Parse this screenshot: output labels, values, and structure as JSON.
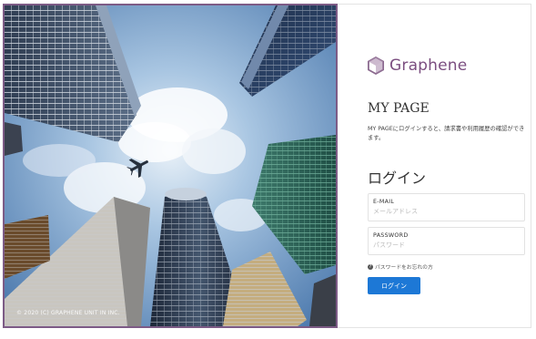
{
  "hero": {
    "copyright": "© 2020 (C) GRAPHENE UNIT IN INC."
  },
  "brand": {
    "name": "Graphene",
    "color": "#7b4e80"
  },
  "page": {
    "title": "MY PAGE",
    "intro": "MY PAGEにログインすると、請求書や利用履歴の確認ができます。"
  },
  "login": {
    "heading": "ログイン",
    "email_label": "E-MAIL",
    "email_placeholder": "メールアドレス",
    "password_label": "PASSWORD",
    "password_placeholder": "パスワード",
    "forgot_label": "パスワードをお忘れの方",
    "submit_label": "ログイン",
    "button_color": "#1d78d6"
  }
}
